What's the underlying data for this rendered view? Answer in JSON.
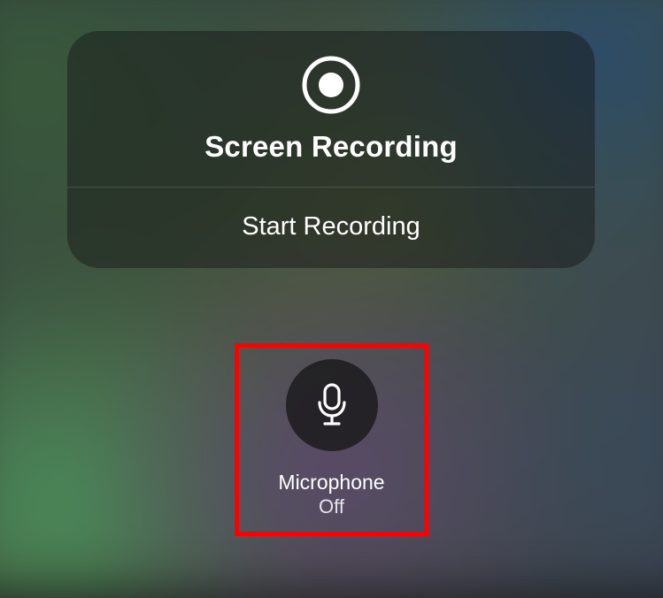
{
  "recording": {
    "title": "Screen Recording",
    "start_label": "Start Recording"
  },
  "microphone": {
    "label": "Microphone",
    "status": "Off"
  },
  "colors": {
    "highlight": "#ff0000"
  }
}
